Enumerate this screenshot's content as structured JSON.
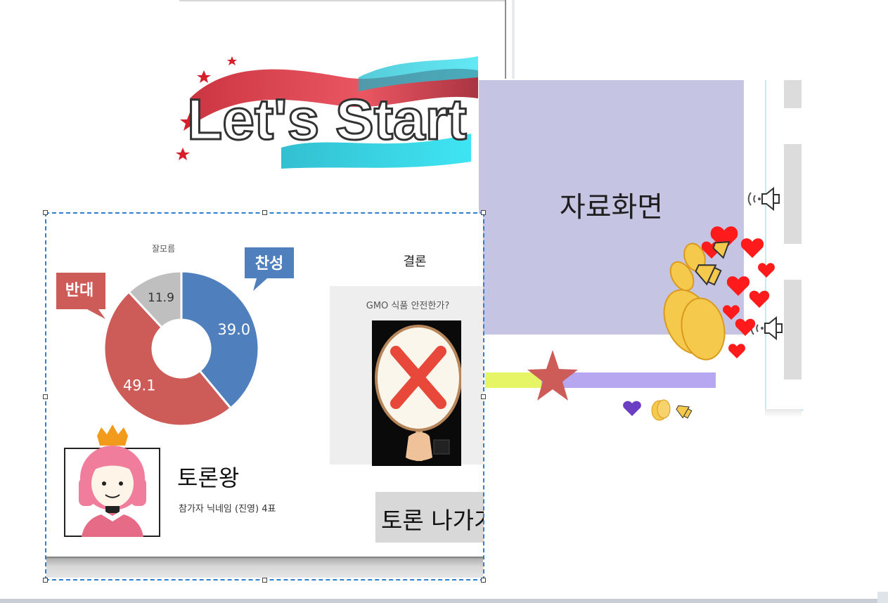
{
  "logo": {
    "text": "Let's Start"
  },
  "material_screen": {
    "title": "자료화면"
  },
  "poll": {
    "chart_data": {
      "type": "pie",
      "categories": [
        "찬성",
        "반대",
        "잘모름"
      ],
      "values": [
        39.0,
        49.1,
        11.9
      ],
      "labels": [
        "39.0",
        "49.1",
        "11.9"
      ],
      "colors": [
        "#4f7fbd",
        "#cd5b58",
        "#bfbfbf"
      ]
    },
    "callout_yes": "찬성",
    "callout_no": "반대",
    "small_label_unknown": "잘모름"
  },
  "conclusion": {
    "label": "결론",
    "question": "GMO 식품 안전한가?",
    "sign": "cross-sign"
  },
  "king": {
    "title": "토론왕",
    "subtitle": "참가자 닉네임 (진영) 4표"
  },
  "exit_button": {
    "label": "토론 나가기"
  },
  "icons": {
    "speaker": "speaker-icon",
    "reactions": [
      "heart-icon",
      "clap-icon",
      "megaphone-icon"
    ]
  }
}
